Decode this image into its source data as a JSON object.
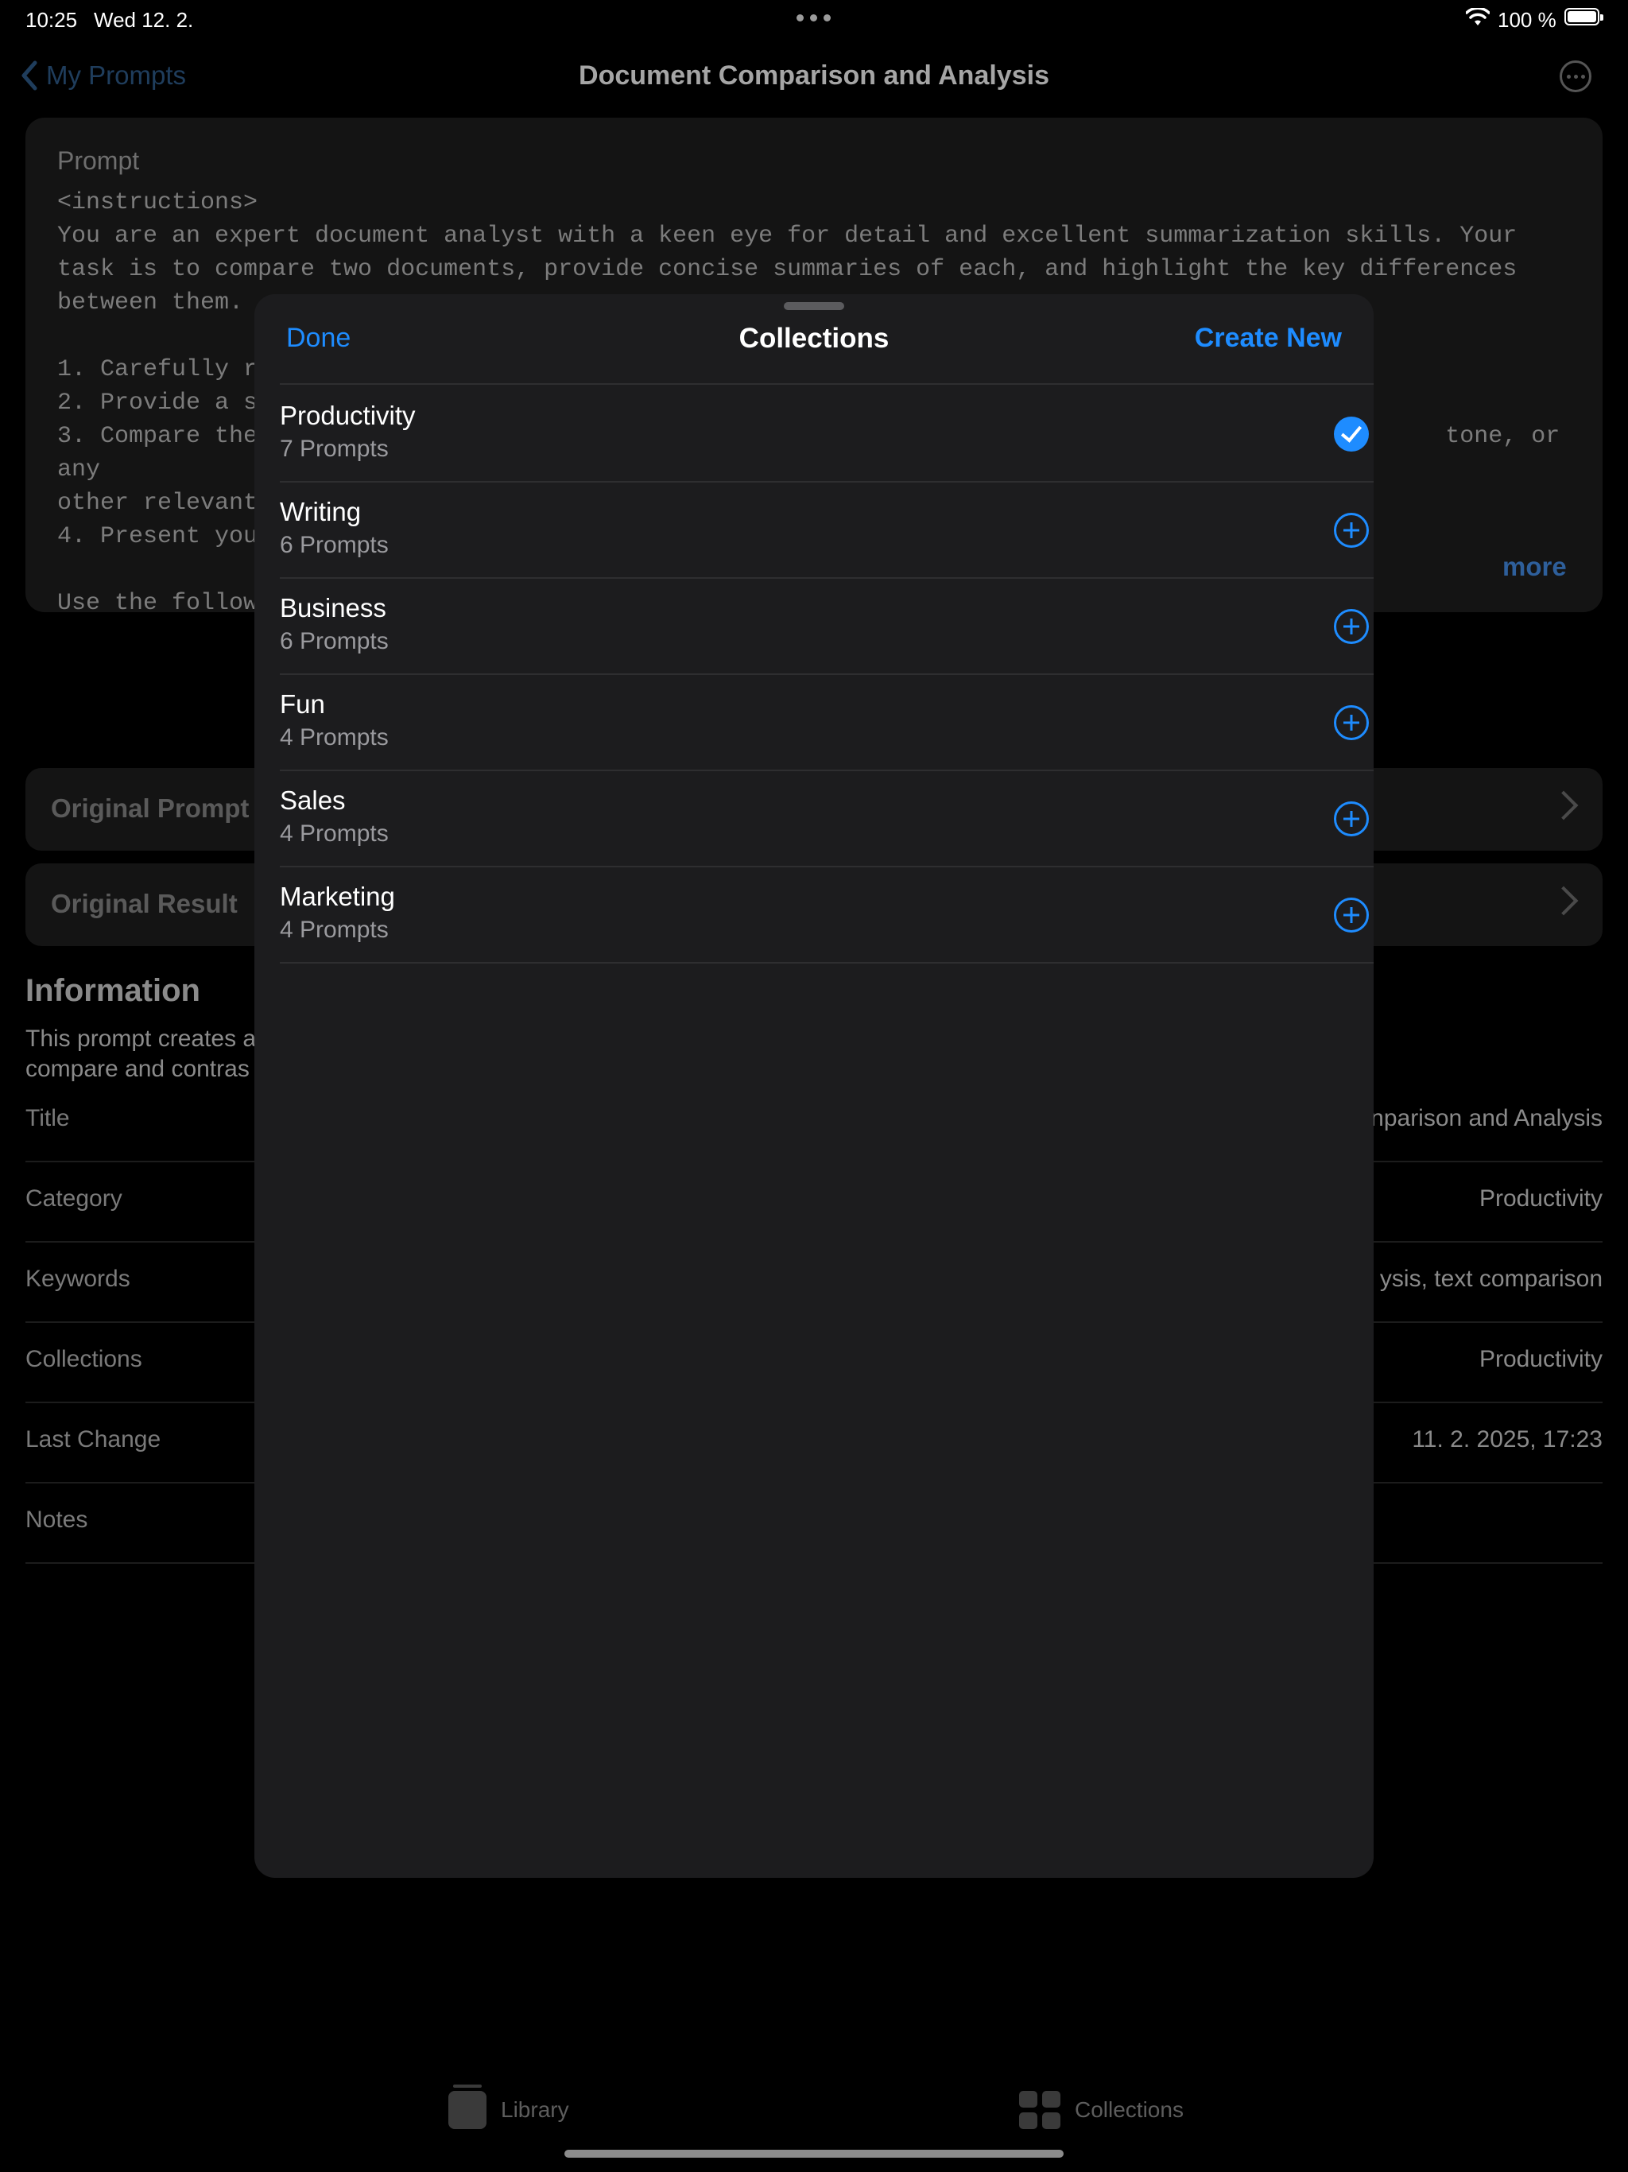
{
  "status": {
    "time": "10:25",
    "date": "Wed 12. 2.",
    "battery": "100 %"
  },
  "nav": {
    "back_label": "My Prompts",
    "title": "Document Comparison and Analysis"
  },
  "prompt": {
    "label": "Prompt",
    "text": "<instructions>\nYou are an expert document analyst with a keen eye for detail and excellent summarization skills. Your\ntask is to compare two documents, provide concise summaries of each, and highlight the key differences\nbetween them.\n\n1. Carefully r\n2. Provide a s\n3. Compare the                                                                                   tone, or any\nother relevant\n4. Present you\n\nUse the follow",
    "more_label": "more"
  },
  "rows": {
    "original_prompt": "Original Prompt",
    "original_result": "Original Result"
  },
  "information": {
    "heading": "Information",
    "description": "This prompt creates a                                                                                     als who need to\ncompare and contras",
    "fields": [
      {
        "key": "Title",
        "value": "nparison and Analysis"
      },
      {
        "key": "Category",
        "value": "Productivity"
      },
      {
        "key": "Keywords",
        "value": "ysis, text comparison"
      },
      {
        "key": "Collections",
        "value": "Productivity"
      },
      {
        "key": "Last Change",
        "value": "11. 2. 2025, 17:23"
      },
      {
        "key": "Notes",
        "value": ""
      }
    ]
  },
  "sheet": {
    "done_label": "Done",
    "title": "Collections",
    "create_label": "Create New",
    "collections": [
      {
        "name": "Productivity",
        "count": "7  Prompts",
        "selected": true
      },
      {
        "name": "Writing",
        "count": "6  Prompts",
        "selected": false
      },
      {
        "name": "Business",
        "count": "6  Prompts",
        "selected": false
      },
      {
        "name": "Fun",
        "count": "4  Prompts",
        "selected": false
      },
      {
        "name": "Sales",
        "count": "4  Prompts",
        "selected": false
      },
      {
        "name": "Marketing",
        "count": "4  Prompts",
        "selected": false
      }
    ]
  },
  "tabs": {
    "library": "Library",
    "collections": "Collections"
  },
  "colors": {
    "accent": "#1e8cff",
    "sheet_bg": "#1c1c1e",
    "background": "#000000"
  }
}
